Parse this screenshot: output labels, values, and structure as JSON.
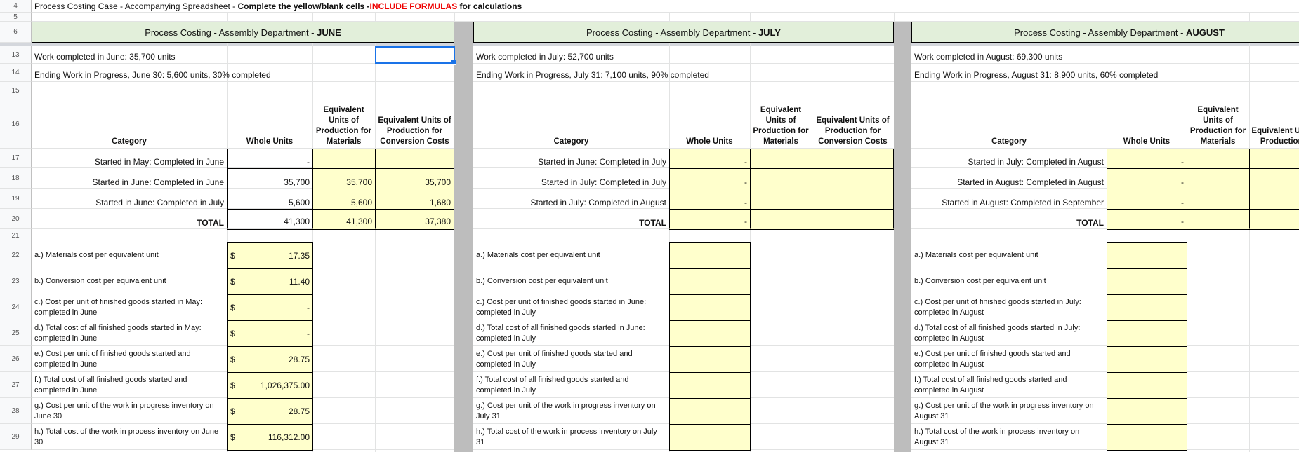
{
  "title": {
    "prefix": "Process Costing Case - Accompanying Spreadsheet - ",
    "bold": "Complete the yellow/blank cells -",
    "red": "INCLUDE FORMULAS",
    "suffix": " for calculations"
  },
  "row_numbers": [
    "4",
    "5",
    "6",
    "13",
    "14",
    "15",
    "16",
    "17",
    "18",
    "19",
    "20",
    "21",
    "22",
    "23",
    "24",
    "25",
    "26",
    "27",
    "28",
    "29"
  ],
  "panels": [
    {
      "header_prefix": "Process Costing - Assembly Department - ",
      "month": "JUNE",
      "work_completed": "Work completed in June: 35,700 units",
      "ending_wip": "Ending Work in Progress, June 30: 5,600 units, 30% completed",
      "col_headers": {
        "category": "Category",
        "whole": "Whole Units",
        "mat": "Equivalent Units of Production for Materials",
        "conv": "Equivalent Units of Production for Conversion Costs"
      },
      "rows": [
        {
          "category": "Started in May: Completed in June",
          "whole": "-",
          "mat": "",
          "conv": ""
        },
        {
          "category": "Started in June: Completed in June",
          "whole": "35,700",
          "mat": "35,700",
          "conv": "35,700"
        },
        {
          "category": "Started in June: Completed in July",
          "whole": "5,600",
          "mat": "5,600",
          "conv": "1,680"
        },
        {
          "category": "TOTAL",
          "whole": "41,300",
          "mat": "41,300",
          "conv": "37,380"
        }
      ],
      "questions": [
        {
          "label": "a.) Materials cost per equivalent unit",
          "currency": "$",
          "value": "17.35"
        },
        {
          "label": "b.) Conversion cost per equivalent unit",
          "currency": "$",
          "value": "11.40"
        },
        {
          "label": "c.) Cost per unit of finished goods started in May: completed in June",
          "currency": "$",
          "value": "-"
        },
        {
          "label": "d.) Total cost of all finished goods started in May: completed in June",
          "currency": "$",
          "value": "-"
        },
        {
          "label": "e.) Cost per unit of finished goods started and completed in June",
          "currency": "$",
          "value": "28.75"
        },
        {
          "label": "f.) Total cost of all finished goods started and completed in June",
          "currency": "$",
          "value": "1,026,375.00"
        },
        {
          "label": "g.) Cost per unit of the work in progress inventory on June 30",
          "currency": "$",
          "value": "28.75"
        },
        {
          "label": "h.) Total cost of the work in process inventory on June 30",
          "currency": "$",
          "value": "116,312.00"
        }
      ]
    },
    {
      "header_prefix": "Process Costing - Assembly Department - ",
      "month": "JULY",
      "work_completed": "Work completed in July: 52,700 units",
      "ending_wip": "Ending Work in Progress, July 31: 7,100 units, 90% completed",
      "col_headers": {
        "category": "Category",
        "whole": "Whole Units",
        "mat": "Equivalent Units of Production for Materials",
        "conv": "Equivalent Units of Production for Conversion Costs"
      },
      "rows": [
        {
          "category": "Started in June: Completed in July",
          "whole": "-",
          "mat": "",
          "conv": ""
        },
        {
          "category": "Started in July: Completed in July",
          "whole": "-",
          "mat": "",
          "conv": ""
        },
        {
          "category": "Started in July: Completed in August",
          "whole": "-",
          "mat": "",
          "conv": ""
        },
        {
          "category": "TOTAL",
          "whole": "-",
          "mat": "",
          "conv": ""
        }
      ],
      "questions": [
        {
          "label": "a.) Materials cost per equivalent unit",
          "currency": "",
          "value": ""
        },
        {
          "label": "b.) Conversion cost per equivalent unit",
          "currency": "",
          "value": ""
        },
        {
          "label": "c.) Cost per unit of finished goods started in June: completed in July",
          "currency": "",
          "value": ""
        },
        {
          "label": "d.) Total cost of all finished goods started in June: completed in July",
          "currency": "",
          "value": ""
        },
        {
          "label": "e.) Cost per unit of finished goods started and completed in July",
          "currency": "",
          "value": ""
        },
        {
          "label": "f.) Total cost of all finished goods started and completed in July",
          "currency": "",
          "value": ""
        },
        {
          "label": "g.) Cost per unit of the work in progress inventory on July 31",
          "currency": "",
          "value": ""
        },
        {
          "label": "h.) Total cost of the work in process inventory on July 31",
          "currency": "",
          "value": ""
        }
      ]
    },
    {
      "header_prefix": "Process Costing - Assembly Department - ",
      "month": "AUGUST",
      "work_completed": "Work completed in August: 69,300 units",
      "ending_wip": "Ending Work in Progress, August 31: 8,900 units, 60% completed",
      "col_headers": {
        "category": "Category",
        "whole": "Whole Units",
        "mat": "Equivalent Units of Production for Materials",
        "conv": "Equivalent Units of Production for"
      },
      "rows": [
        {
          "category": "Started in July: Completed in August",
          "whole": "-",
          "mat": "",
          "conv": ""
        },
        {
          "category": "Started in August: Completed in August",
          "whole": "-",
          "mat": "",
          "conv": ""
        },
        {
          "category": "Started in August: Completed in September",
          "whole": "-",
          "mat": "",
          "conv": ""
        },
        {
          "category": "TOTAL",
          "whole": "-",
          "mat": "",
          "conv": ""
        }
      ],
      "questions": [
        {
          "label": "a.) Materials cost per equivalent unit",
          "currency": "",
          "value": ""
        },
        {
          "label": "b.) Conversion cost per equivalent unit",
          "currency": "",
          "value": ""
        },
        {
          "label": "c.) Cost per unit of finished goods started in July: completed in August",
          "currency": "",
          "value": ""
        },
        {
          "label": "d.) Total cost of all finished goods started in July: completed in August",
          "currency": "",
          "value": ""
        },
        {
          "label": "e.) Cost per unit of finished goods started and completed in August",
          "currency": "",
          "value": ""
        },
        {
          "label": "f.) Total cost of all finished goods started and completed in August",
          "currency": "",
          "value": ""
        },
        {
          "label": "g.) Cost per unit of the work in progress inventory on August 31",
          "currency": "",
          "value": ""
        },
        {
          "label": "h.) Total cost of the work in process inventory on August 31",
          "currency": "",
          "value": ""
        }
      ]
    }
  ]
}
